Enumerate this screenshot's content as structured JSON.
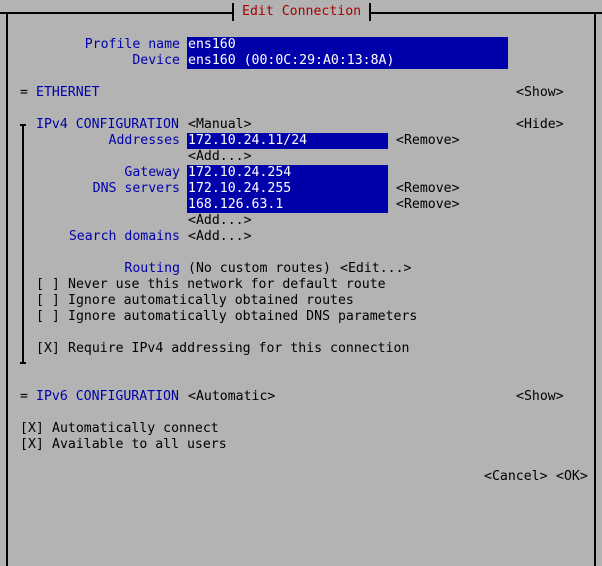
{
  "window": {
    "title": "Edit Connection"
  },
  "profile": {
    "profile_name_label": "Profile name",
    "profile_name_value": "ens160",
    "device_label": "Device",
    "device_value": "ens160 (00:0C:29:A0:13:8A)"
  },
  "ethernet": {
    "marker": "=",
    "label": "ETHERNET",
    "toggle": "<Show>"
  },
  "ipv4": {
    "marker": "╤",
    "label": "IPv4 CONFIGURATION",
    "method": "<Manual>",
    "toggle": "<Hide>",
    "addresses_label": "Addresses",
    "addresses": [
      "172.10.24.11/24"
    ],
    "remove_label": "<Remove>",
    "add_label": "<Add...>",
    "gateway_label": "Gateway",
    "gateway_value": "172.10.24.254",
    "dns_label": "DNS servers",
    "dns": [
      "172.10.24.255",
      "168.126.63.1"
    ],
    "search_domains_label": "Search domains",
    "routing_label": "Routing",
    "routing_value": "(No custom routes)",
    "edit_label": "<Edit...>",
    "never_default": {
      "box": "[ ]",
      "label": "Never use this network for default route"
    },
    "ignore_routes": {
      "box": "[ ]",
      "label": "Ignore automatically obtained routes"
    },
    "ignore_dns": {
      "box": "[ ]",
      "label": "Ignore automatically obtained DNS parameters"
    },
    "require_ipv4": {
      "box": "[X]",
      "label": "Require IPv4 addressing for this connection"
    }
  },
  "ipv6": {
    "marker": "=",
    "label": "IPv6 CONFIGURATION",
    "method": "<Automatic>",
    "toggle": "<Show>"
  },
  "options": {
    "auto_connect": {
      "box": "[X]",
      "label": "Automatically connect"
    },
    "all_users": {
      "box": "[X]",
      "label": "Available to all users"
    }
  },
  "buttons": {
    "cancel": "<Cancel>",
    "ok": "<OK>"
  }
}
